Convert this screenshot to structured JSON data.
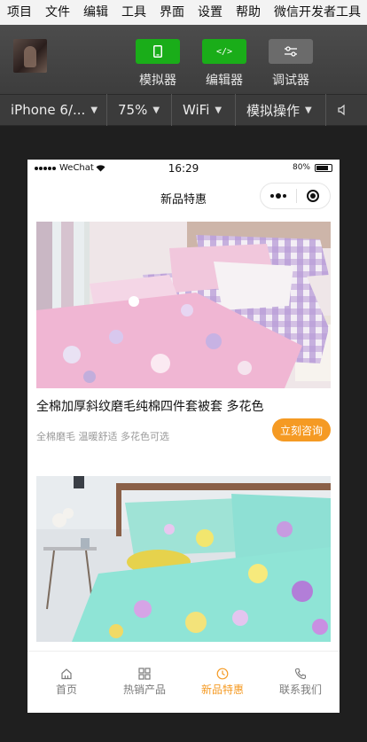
{
  "menubar": {
    "items": [
      "项目",
      "文件",
      "编辑",
      "工具",
      "界面",
      "设置",
      "帮助",
      "微信开发者工具"
    ]
  },
  "toolbar": {
    "simulator_label": "模拟器",
    "editor_label": "编辑器",
    "debugger_label": "调试器",
    "editor_icon_text": "</>"
  },
  "devicebar": {
    "device": "iPhone 6/...",
    "zoom": "75%",
    "network": "WiFi",
    "simulate": "模拟操作"
  },
  "phone": {
    "status": {
      "carrier": "WeChat",
      "time": "16:29",
      "battery": "80%"
    },
    "nav_title": "新品特惠",
    "products": [
      {
        "title": "全棉加厚斜纹磨毛纯棉四件套被套 多花色",
        "desc": "全棉磨毛 温暖舒适 多花色可选",
        "button": "立刻咨询"
      },
      {
        "title": "",
        "desc": "",
        "button": ""
      }
    ],
    "tabs": [
      {
        "label": "首页",
        "icon": "home-icon",
        "active": false
      },
      {
        "label": "热销产品",
        "icon": "grid-icon",
        "active": false
      },
      {
        "label": "新品特惠",
        "icon": "clock-icon",
        "active": true
      },
      {
        "label": "联系我们",
        "icon": "phone-icon",
        "active": false
      }
    ],
    "colors": {
      "accent": "#f59a23",
      "tab_inactive": "#7a7a7a",
      "toolbar_green": "#1aad19"
    }
  }
}
